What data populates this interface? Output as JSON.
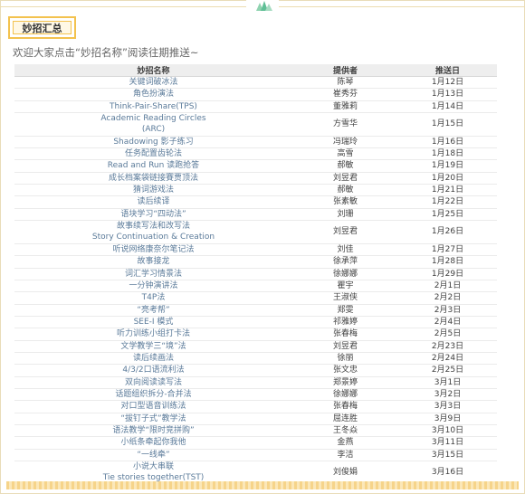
{
  "section_tag": "妙招汇总",
  "intro": "欢迎大家点击“妙招名称”阅读往期推送~",
  "table": {
    "headers": {
      "name": "妙招名称",
      "provider": "提供者",
      "date": "推送日"
    },
    "rows": [
      {
        "lines": [
          "关键词破冰法"
        ],
        "provider": "陈琴",
        "date": "1月12日"
      },
      {
        "lines": [
          "角色扮演法"
        ],
        "provider": "崔秀芬",
        "date": "1月13日"
      },
      {
        "lines": [
          "Think-Pair-Share(TPS)"
        ],
        "provider": "董雅莉",
        "date": "1月14日"
      },
      {
        "lines": [
          "Academic Reading Circles",
          "(ARC)"
        ],
        "provider": "方雪华",
        "date": "1月15日"
      },
      {
        "lines": [
          "Shadowing 影子练习"
        ],
        "provider": "冯瑞玲",
        "date": "1月16日"
      },
      {
        "lines": [
          "任务配置齿轮法"
        ],
        "provider": "高雪",
        "date": "1月18日"
      },
      {
        "lines": [
          "Read and Run 读跑抢答"
        ],
        "provider": "郝敏",
        "date": "1月19日"
      },
      {
        "lines": [
          "成长档案袋链接賽贾顶法"
        ],
        "provider": "刘昱君",
        "date": "1月20日"
      },
      {
        "lines": [
          "猜词游戏法"
        ],
        "provider": "郝敏",
        "date": "1月21日"
      },
      {
        "lines": [
          "读后续译"
        ],
        "provider": "张素敏",
        "date": "1月22日"
      },
      {
        "lines": [
          "语块学习“四动法”"
        ],
        "provider": "刘珊",
        "date": "1月25日"
      },
      {
        "lines": [
          "故事续写法和改写法",
          "Story Continuation & Creation"
        ],
        "provider": "刘昱君",
        "date": "1月26日"
      },
      {
        "lines": [
          "听说网络康奈尔笔记法"
        ],
        "provider": "刘佳",
        "date": "1月27日"
      },
      {
        "lines": [
          "故事接龙"
        ],
        "provider": "徐承萍",
        "date": "1月28日"
      },
      {
        "lines": [
          "词汇学习情景法"
        ],
        "provider": "徐娜娜",
        "date": "1月29日"
      },
      {
        "lines": [
          "一分钟演讲法"
        ],
        "provider": "瞿宇",
        "date": "2月1日"
      },
      {
        "lines": [
          "T4P法"
        ],
        "provider": "王淑侠",
        "date": "2月2日"
      },
      {
        "lines": [
          "“亮考帮”"
        ],
        "provider": "郑雯",
        "date": "2月3日"
      },
      {
        "lines": [
          "SEE-I 模式"
        ],
        "provider": "祁雅婷",
        "date": "2月4日"
      },
      {
        "lines": [
          "听力训练小组打卡法"
        ],
        "provider": "张春梅",
        "date": "2月5日"
      },
      {
        "lines": [
          "文学教学三“境”法"
        ],
        "provider": "刘昱君",
        "date": "2月23日"
      },
      {
        "lines": [
          "读后续画法"
        ],
        "provider": "徐丽",
        "date": "2月24日"
      },
      {
        "lines": [
          "4/3/2口语流利法"
        ],
        "provider": "张文忠",
        "date": "2月25日"
      },
      {
        "lines": [
          "双向阅读读写法"
        ],
        "provider": "郑景婷",
        "date": "3月1日"
      },
      {
        "lines": [
          "话题组织拆分-合并法"
        ],
        "provider": "徐娜娜",
        "date": "3月2日"
      },
      {
        "lines": [
          "对口型语音训练法"
        ],
        "provider": "张春梅",
        "date": "3月3日"
      },
      {
        "lines": [
          "“拔钉子式”教学法"
        ],
        "provider": "屈连胜",
        "date": "3月9日"
      },
      {
        "lines": [
          "语法教学“限时竞拼购”"
        ],
        "provider": "王冬焱",
        "date": "3月10日"
      },
      {
        "lines": [
          "小纸条牵起你我他"
        ],
        "provider": "金燕",
        "date": "3月11日"
      },
      {
        "lines": [
          "“一线牵”"
        ],
        "provider": "李洁",
        "date": "3月15日"
      },
      {
        "lines": [
          "小说大串联",
          "Tie stories together(TST)"
        ],
        "provider": "刘俊娟",
        "date": "3月16日"
      }
    ]
  }
}
